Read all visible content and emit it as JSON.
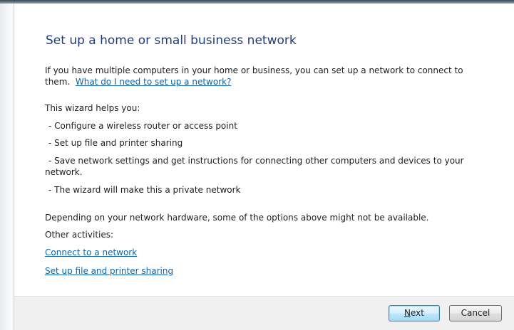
{
  "wizard": {
    "title": "Set up a home or small business network",
    "intro_line1": "If you have multiple computers in your home or business, you can set up a network to connect to",
    "intro_line2_prefix": "them.",
    "help_link": "What do I need to set up a network?",
    "helps_heading": "This wizard helps you:",
    "bullets": [
      "- Configure a wireless router or access point",
      "- Set up file and printer sharing",
      "- Save network settings and get instructions for connecting other computers and devices to your",
      "- The wizard will make this a private network"
    ],
    "bullet3_continuation": "network.",
    "availability_note": "Depending on your network hardware, some of the options above might not be available.",
    "other_activities_label": "Other activities:",
    "activities": [
      "Connect to a network",
      "Set up file and printer sharing"
    ]
  },
  "footer": {
    "next_accel": "N",
    "next_rest": "ext",
    "cancel_label": "Cancel"
  }
}
